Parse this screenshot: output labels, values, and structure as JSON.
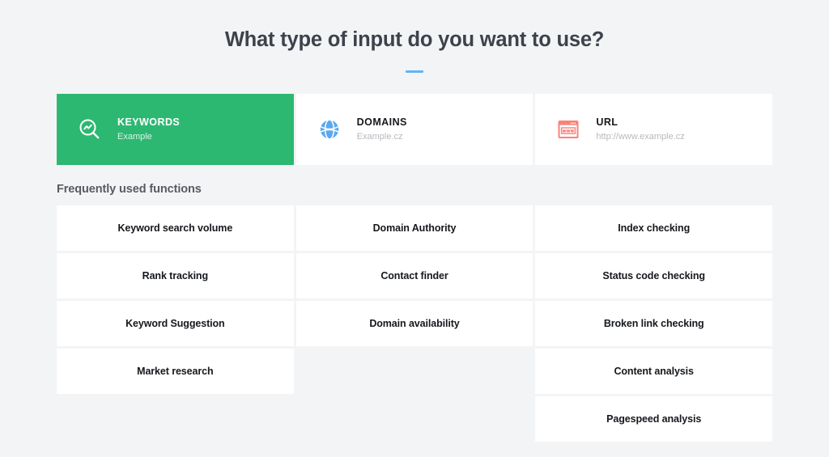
{
  "header": {
    "title": "What type of input do you want to use?",
    "accent_color": "#64b2f6"
  },
  "input_types": {
    "active_index": 0,
    "active_color": "#2db872",
    "items": [
      {
        "icon": "magnifier-trend-icon",
        "label": "KEYWORDS",
        "example": "Example",
        "selected": "true"
      },
      {
        "icon": "globe-icon",
        "label": "DOMAINS",
        "example": "Example.cz",
        "selected": "false"
      },
      {
        "icon": "browser-window-www-icon",
        "label": "URL",
        "example": "http://www.example.cz",
        "selected": "false"
      }
    ]
  },
  "functions": {
    "section_label": "Frequently used functions",
    "columns": [
      {
        "items": [
          "Keyword search volume",
          "Rank tracking",
          "Keyword Suggestion",
          "Market research"
        ]
      },
      {
        "items": [
          "Domain Authority",
          "Contact finder",
          "Domain availability"
        ]
      },
      {
        "items": [
          "Index checking",
          "Status code checking",
          "Broken link checking",
          "Content analysis",
          "Pagespeed analysis"
        ]
      }
    ]
  }
}
